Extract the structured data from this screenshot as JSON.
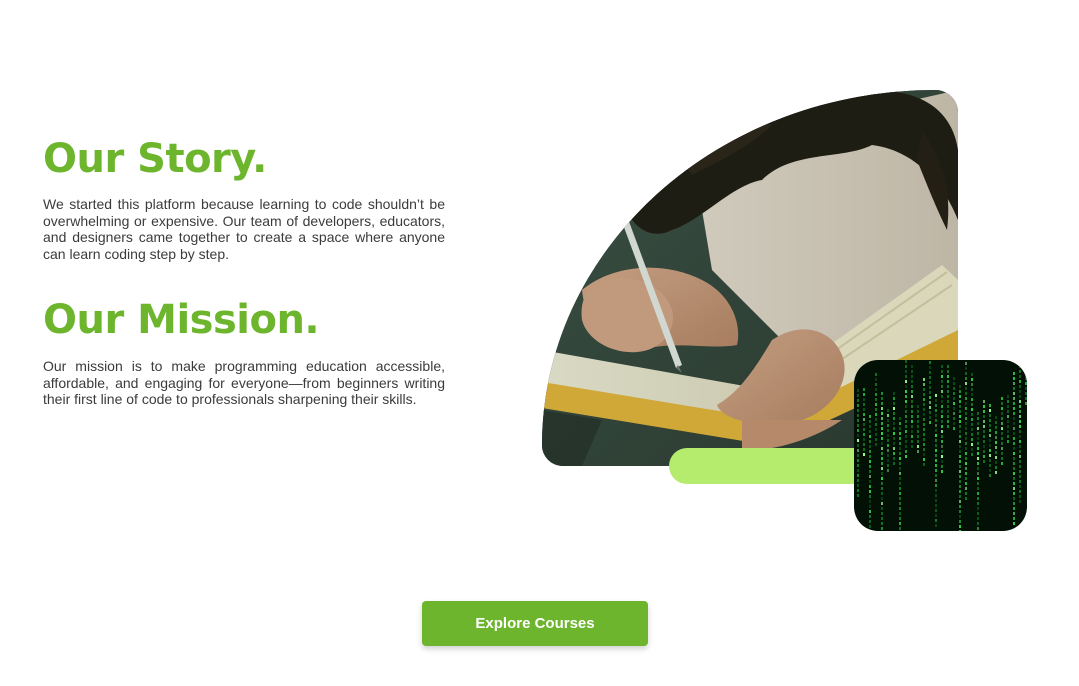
{
  "story": {
    "title": "Our Story.",
    "text": "We started this platform because learning to code shouldn’t be overwhelming or expensive. Our team of developers, educators, and designers came together to create a space where anyone can learn coding step by step."
  },
  "mission": {
    "title": "Our Mission.",
    "text": "Our mission is to make programming education accessible, affordable, and engaging for everyone—from beginners writing their first line of code to professionals sharpening their skills."
  },
  "cta": {
    "label": "Explore Courses"
  },
  "images": {
    "photo": "person-writing-in-notebook-photo",
    "code_tile": "green-code-rain-image"
  },
  "colors": {
    "brand_green": "#6cb52d",
    "accent_lime": "#b5ec6e",
    "body_text": "#3b3b3b"
  }
}
